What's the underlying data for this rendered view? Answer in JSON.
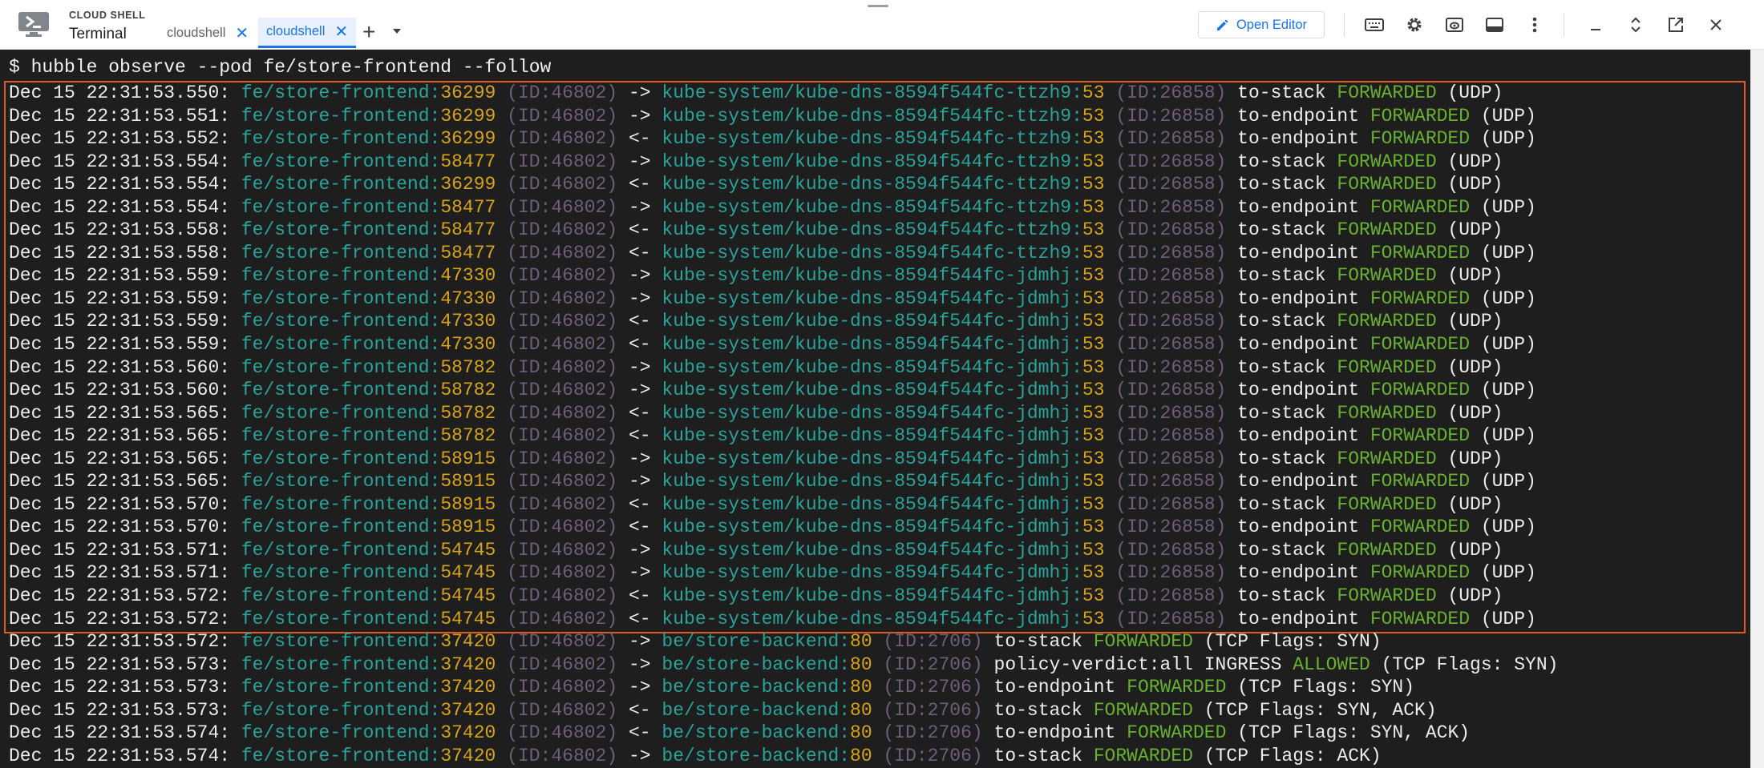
{
  "header": {
    "brand_small": "CLOUD SHELL",
    "brand_title": "Terminal",
    "tabs": [
      {
        "label": "cloudshell",
        "active": false
      },
      {
        "label": "cloudshell",
        "active": true
      }
    ],
    "add_tab": "+",
    "open_editor_label": "Open Editor",
    "toolbar_icons": [
      "keyboard-icon",
      "gear-icon",
      "preview-icon",
      "terminal-layout-icon",
      "more-vert-icon",
      "minimize-icon",
      "maximize-icon",
      "open-new-window-icon",
      "close-icon"
    ],
    "accent_color": "#1a73e8"
  },
  "terminal": {
    "command": "$ hubble observe --pod fe/store-frontend --follow",
    "lines": [
      {
        "ts": "Dec 15 22:31:53.550:",
        "src": "fe/store-frontend:",
        "sport": "36299",
        "sid": "(ID:46802)",
        "dir": "->",
        "dst": "kube-system/kube-dns-8594f544fc-ttzh9:",
        "dport": "53",
        "did": "(ID:26858)",
        "obs": "to-stack",
        "verdict": "FORWARDED",
        "info": "(UDP)"
      },
      {
        "ts": "Dec 15 22:31:53.551:",
        "src": "fe/store-frontend:",
        "sport": "36299",
        "sid": "(ID:46802)",
        "dir": "->",
        "dst": "kube-system/kube-dns-8594f544fc-ttzh9:",
        "dport": "53",
        "did": "(ID:26858)",
        "obs": "to-endpoint",
        "verdict": "FORWARDED",
        "info": "(UDP)"
      },
      {
        "ts": "Dec 15 22:31:53.552:",
        "src": "fe/store-frontend:",
        "sport": "36299",
        "sid": "(ID:46802)",
        "dir": "<-",
        "dst": "kube-system/kube-dns-8594f544fc-ttzh9:",
        "dport": "53",
        "did": "(ID:26858)",
        "obs": "to-endpoint",
        "verdict": "FORWARDED",
        "info": "(UDP)"
      },
      {
        "ts": "Dec 15 22:31:53.554:",
        "src": "fe/store-frontend:",
        "sport": "58477",
        "sid": "(ID:46802)",
        "dir": "->",
        "dst": "kube-system/kube-dns-8594f544fc-ttzh9:",
        "dport": "53",
        "did": "(ID:26858)",
        "obs": "to-stack",
        "verdict": "FORWARDED",
        "info": "(UDP)"
      },
      {
        "ts": "Dec 15 22:31:53.554:",
        "src": "fe/store-frontend:",
        "sport": "36299",
        "sid": "(ID:46802)",
        "dir": "<-",
        "dst": "kube-system/kube-dns-8594f544fc-ttzh9:",
        "dport": "53",
        "did": "(ID:26858)",
        "obs": "to-stack",
        "verdict": "FORWARDED",
        "info": "(UDP)"
      },
      {
        "ts": "Dec 15 22:31:53.554:",
        "src": "fe/store-frontend:",
        "sport": "58477",
        "sid": "(ID:46802)",
        "dir": "->",
        "dst": "kube-system/kube-dns-8594f544fc-ttzh9:",
        "dport": "53",
        "did": "(ID:26858)",
        "obs": "to-endpoint",
        "verdict": "FORWARDED",
        "info": "(UDP)"
      },
      {
        "ts": "Dec 15 22:31:53.558:",
        "src": "fe/store-frontend:",
        "sport": "58477",
        "sid": "(ID:46802)",
        "dir": "<-",
        "dst": "kube-system/kube-dns-8594f544fc-ttzh9:",
        "dport": "53",
        "did": "(ID:26858)",
        "obs": "to-stack",
        "verdict": "FORWARDED",
        "info": "(UDP)"
      },
      {
        "ts": "Dec 15 22:31:53.558:",
        "src": "fe/store-frontend:",
        "sport": "58477",
        "sid": "(ID:46802)",
        "dir": "<-",
        "dst": "kube-system/kube-dns-8594f544fc-ttzh9:",
        "dport": "53",
        "did": "(ID:26858)",
        "obs": "to-endpoint",
        "verdict": "FORWARDED",
        "info": "(UDP)"
      },
      {
        "ts": "Dec 15 22:31:53.559:",
        "src": "fe/store-frontend:",
        "sport": "47330",
        "sid": "(ID:46802)",
        "dir": "->",
        "dst": "kube-system/kube-dns-8594f544fc-jdmhj:",
        "dport": "53",
        "did": "(ID:26858)",
        "obs": "to-stack",
        "verdict": "FORWARDED",
        "info": "(UDP)"
      },
      {
        "ts": "Dec 15 22:31:53.559:",
        "src": "fe/store-frontend:",
        "sport": "47330",
        "sid": "(ID:46802)",
        "dir": "->",
        "dst": "kube-system/kube-dns-8594f544fc-jdmhj:",
        "dport": "53",
        "did": "(ID:26858)",
        "obs": "to-endpoint",
        "verdict": "FORWARDED",
        "info": "(UDP)"
      },
      {
        "ts": "Dec 15 22:31:53.559:",
        "src": "fe/store-frontend:",
        "sport": "47330",
        "sid": "(ID:46802)",
        "dir": "<-",
        "dst": "kube-system/kube-dns-8594f544fc-jdmhj:",
        "dport": "53",
        "did": "(ID:26858)",
        "obs": "to-stack",
        "verdict": "FORWARDED",
        "info": "(UDP)"
      },
      {
        "ts": "Dec 15 22:31:53.559:",
        "src": "fe/store-frontend:",
        "sport": "47330",
        "sid": "(ID:46802)",
        "dir": "<-",
        "dst": "kube-system/kube-dns-8594f544fc-jdmhj:",
        "dport": "53",
        "did": "(ID:26858)",
        "obs": "to-endpoint",
        "verdict": "FORWARDED",
        "info": "(UDP)"
      },
      {
        "ts": "Dec 15 22:31:53.560:",
        "src": "fe/store-frontend:",
        "sport": "58782",
        "sid": "(ID:46802)",
        "dir": "->",
        "dst": "kube-system/kube-dns-8594f544fc-jdmhj:",
        "dport": "53",
        "did": "(ID:26858)",
        "obs": "to-stack",
        "verdict": "FORWARDED",
        "info": "(UDP)"
      },
      {
        "ts": "Dec 15 22:31:53.560:",
        "src": "fe/store-frontend:",
        "sport": "58782",
        "sid": "(ID:46802)",
        "dir": "->",
        "dst": "kube-system/kube-dns-8594f544fc-jdmhj:",
        "dport": "53",
        "did": "(ID:26858)",
        "obs": "to-endpoint",
        "verdict": "FORWARDED",
        "info": "(UDP)"
      },
      {
        "ts": "Dec 15 22:31:53.565:",
        "src": "fe/store-frontend:",
        "sport": "58782",
        "sid": "(ID:46802)",
        "dir": "<-",
        "dst": "kube-system/kube-dns-8594f544fc-jdmhj:",
        "dport": "53",
        "did": "(ID:26858)",
        "obs": "to-stack",
        "verdict": "FORWARDED",
        "info": "(UDP)"
      },
      {
        "ts": "Dec 15 22:31:53.565:",
        "src": "fe/store-frontend:",
        "sport": "58782",
        "sid": "(ID:46802)",
        "dir": "<-",
        "dst": "kube-system/kube-dns-8594f544fc-jdmhj:",
        "dport": "53",
        "did": "(ID:26858)",
        "obs": "to-endpoint",
        "verdict": "FORWARDED",
        "info": "(UDP)"
      },
      {
        "ts": "Dec 15 22:31:53.565:",
        "src": "fe/store-frontend:",
        "sport": "58915",
        "sid": "(ID:46802)",
        "dir": "->",
        "dst": "kube-system/kube-dns-8594f544fc-jdmhj:",
        "dport": "53",
        "did": "(ID:26858)",
        "obs": "to-stack",
        "verdict": "FORWARDED",
        "info": "(UDP)"
      },
      {
        "ts": "Dec 15 22:31:53.565:",
        "src": "fe/store-frontend:",
        "sport": "58915",
        "sid": "(ID:46802)",
        "dir": "->",
        "dst": "kube-system/kube-dns-8594f544fc-jdmhj:",
        "dport": "53",
        "did": "(ID:26858)",
        "obs": "to-endpoint",
        "verdict": "FORWARDED",
        "info": "(UDP)"
      },
      {
        "ts": "Dec 15 22:31:53.570:",
        "src": "fe/store-frontend:",
        "sport": "58915",
        "sid": "(ID:46802)",
        "dir": "<-",
        "dst": "kube-system/kube-dns-8594f544fc-jdmhj:",
        "dport": "53",
        "did": "(ID:26858)",
        "obs": "to-stack",
        "verdict": "FORWARDED",
        "info": "(UDP)"
      },
      {
        "ts": "Dec 15 22:31:53.570:",
        "src": "fe/store-frontend:",
        "sport": "58915",
        "sid": "(ID:46802)",
        "dir": "<-",
        "dst": "kube-system/kube-dns-8594f544fc-jdmhj:",
        "dport": "53",
        "did": "(ID:26858)",
        "obs": "to-endpoint",
        "verdict": "FORWARDED",
        "info": "(UDP)"
      },
      {
        "ts": "Dec 15 22:31:53.571:",
        "src": "fe/store-frontend:",
        "sport": "54745",
        "sid": "(ID:46802)",
        "dir": "->",
        "dst": "kube-system/kube-dns-8594f544fc-jdmhj:",
        "dport": "53",
        "did": "(ID:26858)",
        "obs": "to-stack",
        "verdict": "FORWARDED",
        "info": "(UDP)"
      },
      {
        "ts": "Dec 15 22:31:53.571:",
        "src": "fe/store-frontend:",
        "sport": "54745",
        "sid": "(ID:46802)",
        "dir": "->",
        "dst": "kube-system/kube-dns-8594f544fc-jdmhj:",
        "dport": "53",
        "did": "(ID:26858)",
        "obs": "to-endpoint",
        "verdict": "FORWARDED",
        "info": "(UDP)"
      },
      {
        "ts": "Dec 15 22:31:53.572:",
        "src": "fe/store-frontend:",
        "sport": "54745",
        "sid": "(ID:46802)",
        "dir": "<-",
        "dst": "kube-system/kube-dns-8594f544fc-jdmhj:",
        "dport": "53",
        "did": "(ID:26858)",
        "obs": "to-stack",
        "verdict": "FORWARDED",
        "info": "(UDP)"
      },
      {
        "ts": "Dec 15 22:31:53.572:",
        "src": "fe/store-frontend:",
        "sport": "54745",
        "sid": "(ID:46802)",
        "dir": "<-",
        "dst": "kube-system/kube-dns-8594f544fc-jdmhj:",
        "dport": "53",
        "did": "(ID:26858)",
        "obs": "to-endpoint",
        "verdict": "FORWARDED",
        "info": "(UDP)"
      },
      {
        "ts": "Dec 15 22:31:53.572:",
        "src": "fe/store-frontend:",
        "sport": "37420",
        "sid": "(ID:46802)",
        "dir": "->",
        "dst": "be/store-backend:",
        "dport": "80",
        "did": "(ID:2706)",
        "obs": "to-stack",
        "verdict": "FORWARDED",
        "info": "(TCP Flags: SYN)"
      },
      {
        "ts": "Dec 15 22:31:53.573:",
        "src": "fe/store-frontend:",
        "sport": "37420",
        "sid": "(ID:46802)",
        "dir": "->",
        "dst": "be/store-backend:",
        "dport": "80",
        "did": "(ID:2706)",
        "obs": "policy-verdict:all INGRESS",
        "verdict": "ALLOWED",
        "info": "(TCP Flags: SYN)"
      },
      {
        "ts": "Dec 15 22:31:53.573:",
        "src": "fe/store-frontend:",
        "sport": "37420",
        "sid": "(ID:46802)",
        "dir": "->",
        "dst": "be/store-backend:",
        "dport": "80",
        "did": "(ID:2706)",
        "obs": "to-endpoint",
        "verdict": "FORWARDED",
        "info": "(TCP Flags: SYN)"
      },
      {
        "ts": "Dec 15 22:31:53.573:",
        "src": "fe/store-frontend:",
        "sport": "37420",
        "sid": "(ID:46802)",
        "dir": "<-",
        "dst": "be/store-backend:",
        "dport": "80",
        "did": "(ID:2706)",
        "obs": "to-stack",
        "verdict": "FORWARDED",
        "info": "(TCP Flags: SYN, ACK)"
      },
      {
        "ts": "Dec 15 22:31:53.574:",
        "src": "fe/store-frontend:",
        "sport": "37420",
        "sid": "(ID:46802)",
        "dir": "<-",
        "dst": "be/store-backend:",
        "dport": "80",
        "did": "(ID:2706)",
        "obs": "to-endpoint",
        "verdict": "FORWARDED",
        "info": "(TCP Flags: SYN, ACK)"
      },
      {
        "ts": "Dec 15 22:31:53.574:",
        "src": "fe/store-frontend:",
        "sport": "37420",
        "sid": "(ID:46802)",
        "dir": "->",
        "dst": "be/store-backend:",
        "dport": "80",
        "did": "(ID:2706)",
        "obs": "to-stack",
        "verdict": "FORWARDED",
        "info": "(TCP Flags: ACK)"
      }
    ],
    "colors": {
      "background": "#1e1e1e",
      "endpoint": "#29a39a",
      "port": "#d7a418",
      "identity": "#6f5d7a",
      "verdict": "#68b030",
      "highlight_box": "#e05a28"
    }
  }
}
